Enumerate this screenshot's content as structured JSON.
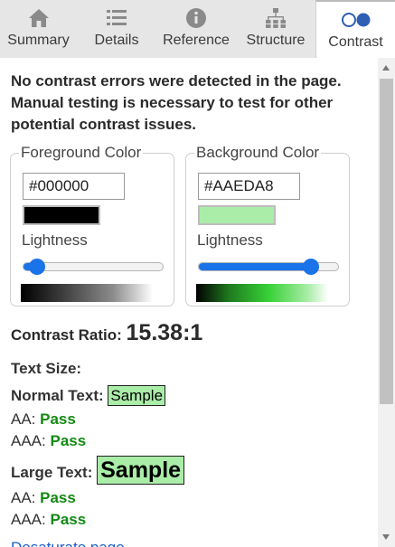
{
  "tabs": [
    {
      "label": "Summary",
      "icon": "home-icon"
    },
    {
      "label": "Details",
      "icon": "list-icon"
    },
    {
      "label": "Reference",
      "icon": "info-icon"
    },
    {
      "label": "Structure",
      "icon": "hierarchy-icon"
    },
    {
      "label": "Contrast",
      "icon": "contrast-icon",
      "active": true
    }
  ],
  "summary": "No contrast errors were detected in the page. Manual testing is necessary to test for other potential contrast issues.",
  "foreground": {
    "legend": "Foreground Color",
    "value": "#000000",
    "lightness_label": "Lightness",
    "lightness": 0.1,
    "swatch_color": "#000000"
  },
  "background": {
    "legend": "Background Color",
    "value": "#AAEDA8",
    "lightness_label": "Lightness",
    "lightness": 0.8,
    "swatch_color": "#AAEDA8"
  },
  "contrast": {
    "label": "Contrast Ratio:",
    "value": "15.38:1"
  },
  "text_size_label": "Text Size:",
  "normal_text": {
    "label": "Normal Text:",
    "sample": "Sample",
    "aa_label": "AA:",
    "aa_result": "Pass",
    "aaa_label": "AAA:",
    "aaa_result": "Pass"
  },
  "large_text": {
    "label": "Large Text:",
    "sample": "Sample",
    "aa_label": "AA:",
    "aa_result": "Pass",
    "aaa_label": "AAA:",
    "aaa_result": "Pass"
  },
  "desaturate_link": "Desaturate page",
  "colors": {
    "pass": "#138a13",
    "accent": "#1a73e8",
    "tab_bg": "#e6e6e6"
  }
}
